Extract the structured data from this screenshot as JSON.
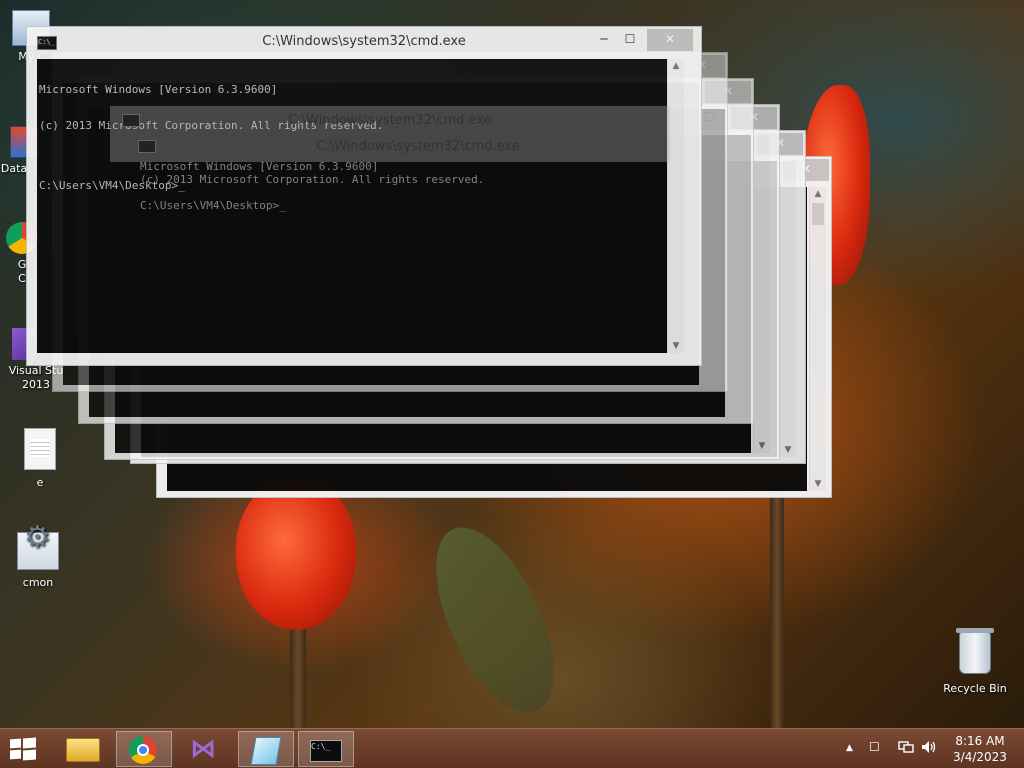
{
  "desktop_icons": [
    {
      "label": "My C",
      "icon": "computer-icon"
    },
    {
      "label": "Data",
      "icon": "shortcut-icon"
    },
    {
      "label": "G",
      "label2": "C",
      "icon": "chrome-icon"
    },
    {
      "label": "Visual Stu",
      "label2": "2013",
      "icon": "visual-studio-icon"
    },
    {
      "label": "e",
      "icon": "text-file-icon"
    },
    {
      "label": "cmon",
      "icon": "settings-file-icon"
    },
    {
      "label": "Recycle Bin",
      "icon": "recycle-bin-icon"
    }
  ],
  "cmd_window": {
    "title": "C:\\Windows\\system32\\cmd.exe",
    "icon_text": "C:\\_",
    "minimize": "─",
    "maximize": "☐",
    "close": "✕",
    "lines": [
      "Microsoft Windows [Version 6.3.9600]",
      "(c) 2013 Microsoft Corporation. All rights reserved.",
      "",
      "C:\\Users\\VM4\\Desktop>_"
    ]
  },
  "taskbar": {
    "items": [
      {
        "name": "file-explorer",
        "icon": "folder-icon"
      },
      {
        "name": "google-chrome",
        "icon": "chrome-icon"
      },
      {
        "name": "visual-studio",
        "icon": "visual-studio-icon"
      },
      {
        "name": "notepad",
        "icon": "notepad-icon"
      },
      {
        "name": "command-prompt",
        "icon": "cmd-icon",
        "icon_text": "C:\\_"
      }
    ],
    "tray": {
      "show_hidden": "▲",
      "flag": "☐",
      "network_icon": "network-icon",
      "volume_icon": "volume-icon"
    },
    "clock": {
      "time": "8:16 AM",
      "date": "3/4/2023"
    }
  },
  "colors": {
    "taskbar": "#6a3c28",
    "console_bg": "#0c0c0c",
    "console_text": "#c0c0c0",
    "window_frame": "#f4f4f4"
  }
}
